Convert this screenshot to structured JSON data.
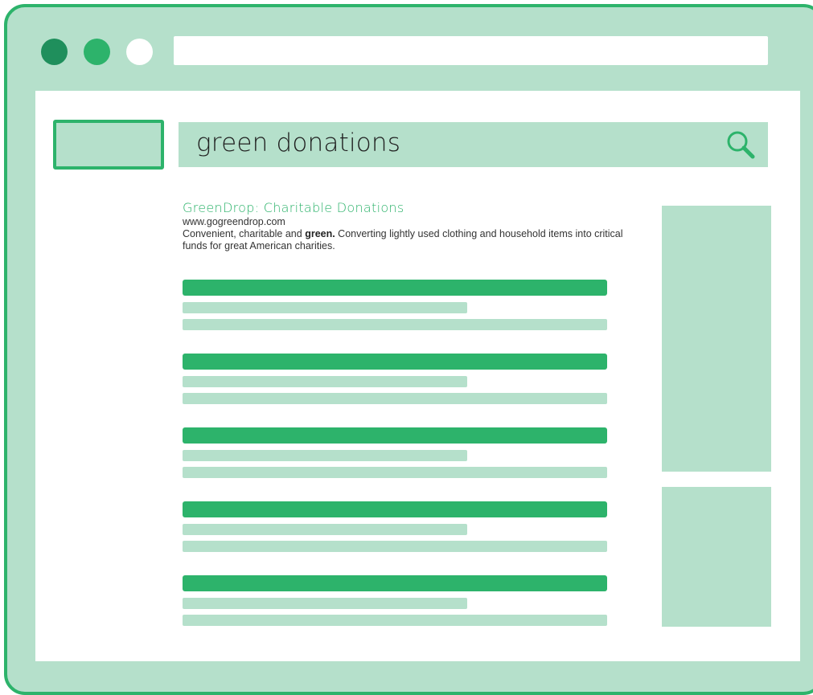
{
  "window": {
    "controls": [
      {
        "name": "close",
        "color": "#1f8f5c"
      },
      {
        "name": "minimize",
        "color": "#2db36b"
      },
      {
        "name": "maximize",
        "color": "#ffffff"
      }
    ],
    "address_bar": {
      "value": ""
    }
  },
  "colors": {
    "frame": "#b5e0cb",
    "accent": "#2db36b",
    "dark_accent": "#1f8f5c",
    "page": "#ffffff"
  },
  "search": {
    "query": "green donations",
    "icon": "search-icon"
  },
  "top_result": {
    "title": "GreenDrop: Charitable Donations",
    "url": "www.gogreendrop.com",
    "snippet_before": "Convenient, charitable and ",
    "snippet_bold": "green.",
    "snippet_after": " Converting lightly used clothing and household items into critical funds for great American charities."
  },
  "placeholder_results": [
    1,
    2,
    3,
    4,
    5
  ],
  "sidebar": {
    "ads": [
      "ad-block-1",
      "ad-block-2"
    ]
  }
}
